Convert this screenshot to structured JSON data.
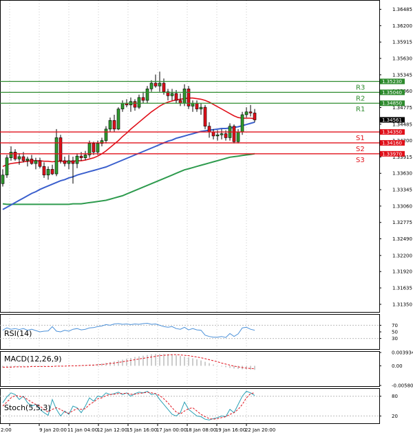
{
  "chart_data": {
    "type": "candlestick",
    "price_axis_ticks": [
      "1.36485",
      "1.36200",
      "1.35915",
      "1.35630",
      "1.35345",
      "1.35060",
      "1.34775",
      "1.34485",
      "1.34200",
      "1.33915",
      "1.33630",
      "1.33345",
      "1.33060",
      "1.32775",
      "1.32490",
      "1.32200",
      "1.31920",
      "1.31635",
      "1.31350"
    ],
    "ylim": [
      1.31205,
      1.36635
    ],
    "x_tick_labels": [
      "2:00",
      "9 Jan 20:00",
      "11 Jan 04:00",
      "12 Jan 12:00",
      "15 Jan 16:00",
      "17 Jan 00:00",
      "18 Jan 08:00",
      "19 Jan 16:00",
      "22 Jan 20:00"
    ],
    "current_price": {
      "label": "1.34561",
      "value": 1.34561
    },
    "levels": [
      {
        "name": "R3",
        "value": 1.3523,
        "label": "1.35230",
        "color": "#2e8b2e"
      },
      {
        "name": "R2",
        "value": 1.3504,
        "label": "1.35040",
        "color": "#2e8b2e"
      },
      {
        "name": "R1",
        "value": 1.3485,
        "label": "1.34850",
        "color": "#2e8b2e"
      },
      {
        "name": "S1",
        "value": 1.3435,
        "label": "1.34350",
        "color": "#e0101a"
      },
      {
        "name": "S2",
        "value": 1.3416,
        "label": "1.34160",
        "color": "#e0101a"
      },
      {
        "name": "S3",
        "value": 1.3397,
        "label": "1.33970",
        "color": "#e0101a"
      }
    ],
    "candles": [
      {
        "o": 1.3345,
        "h": 1.337,
        "l": 1.334,
        "c": 1.336
      },
      {
        "o": 1.336,
        "h": 1.3395,
        "l": 1.3355,
        "c": 1.339
      },
      {
        "o": 1.339,
        "h": 1.341,
        "l": 1.3385,
        "c": 1.34
      },
      {
        "o": 1.34,
        "h": 1.3405,
        "l": 1.3385,
        "c": 1.3388
      },
      {
        "o": 1.3388,
        "h": 1.3398,
        "l": 1.3378,
        "c": 1.3392
      },
      {
        "o": 1.3392,
        "h": 1.34,
        "l": 1.3382,
        "c": 1.3385
      },
      {
        "o": 1.3385,
        "h": 1.3392,
        "l": 1.3375,
        "c": 1.3388
      },
      {
        "o": 1.3388,
        "h": 1.3395,
        "l": 1.3378,
        "c": 1.338
      },
      {
        "o": 1.338,
        "h": 1.339,
        "l": 1.337,
        "c": 1.3385
      },
      {
        "o": 1.3385,
        "h": 1.339,
        "l": 1.3372,
        "c": 1.3375
      },
      {
        "o": 1.3375,
        "h": 1.3382,
        "l": 1.3355,
        "c": 1.336
      },
      {
        "o": 1.336,
        "h": 1.3375,
        "l": 1.3352,
        "c": 1.337
      },
      {
        "o": 1.337,
        "h": 1.3378,
        "l": 1.336,
        "c": 1.3362
      },
      {
        "o": 1.3362,
        "h": 1.344,
        "l": 1.3358,
        "c": 1.3425
      },
      {
        "o": 1.3425,
        "h": 1.343,
        "l": 1.338,
        "c": 1.3385
      },
      {
        "o": 1.3385,
        "h": 1.3392,
        "l": 1.3375,
        "c": 1.338
      },
      {
        "o": 1.338,
        "h": 1.3395,
        "l": 1.337,
        "c": 1.3385
      },
      {
        "o": 1.3385,
        "h": 1.3392,
        "l": 1.3345,
        "c": 1.338
      },
      {
        "o": 1.338,
        "h": 1.3398,
        "l": 1.3372,
        "c": 1.3393
      },
      {
        "o": 1.3393,
        "h": 1.34,
        "l": 1.3385,
        "c": 1.339
      },
      {
        "o": 1.339,
        "h": 1.3402,
        "l": 1.3386,
        "c": 1.3395
      },
      {
        "o": 1.3395,
        "h": 1.342,
        "l": 1.339,
        "c": 1.3415
      },
      {
        "o": 1.3415,
        "h": 1.3418,
        "l": 1.3395,
        "c": 1.34
      },
      {
        "o": 1.34,
        "h": 1.342,
        "l": 1.3395,
        "c": 1.3415
      },
      {
        "o": 1.3415,
        "h": 1.3425,
        "l": 1.341,
        "c": 1.342
      },
      {
        "o": 1.342,
        "h": 1.3445,
        "l": 1.3415,
        "c": 1.344
      },
      {
        "o": 1.344,
        "h": 1.346,
        "l": 1.3435,
        "c": 1.3455
      },
      {
        "o": 1.3455,
        "h": 1.3465,
        "l": 1.3435,
        "c": 1.344
      },
      {
        "o": 1.344,
        "h": 1.3478,
        "l": 1.3438,
        "c": 1.3475
      },
      {
        "o": 1.3475,
        "h": 1.349,
        "l": 1.347,
        "c": 1.3485
      },
      {
        "o": 1.3485,
        "h": 1.3492,
        "l": 1.3478,
        "c": 1.3482
      },
      {
        "o": 1.3482,
        "h": 1.3495,
        "l": 1.347,
        "c": 1.3488
      },
      {
        "o": 1.3488,
        "h": 1.3492,
        "l": 1.3472,
        "c": 1.3478
      },
      {
        "o": 1.3478,
        "h": 1.35,
        "l": 1.3475,
        "c": 1.3495
      },
      {
        "o": 1.3495,
        "h": 1.3505,
        "l": 1.3485,
        "c": 1.349
      },
      {
        "o": 1.349,
        "h": 1.3515,
        "l": 1.3485,
        "c": 1.351
      },
      {
        "o": 1.351,
        "h": 1.3525,
        "l": 1.3505,
        "c": 1.352
      },
      {
        "o": 1.352,
        "h": 1.3535,
        "l": 1.3512,
        "c": 1.3515
      },
      {
        "o": 1.3515,
        "h": 1.354,
        "l": 1.3505,
        "c": 1.352
      },
      {
        "o": 1.352,
        "h": 1.3528,
        "l": 1.35,
        "c": 1.3505
      },
      {
        "o": 1.3505,
        "h": 1.351,
        "l": 1.349,
        "c": 1.3498
      },
      {
        "o": 1.3498,
        "h": 1.351,
        "l": 1.349,
        "c": 1.3502
      },
      {
        "o": 1.3502,
        "h": 1.3508,
        "l": 1.3485,
        "c": 1.349
      },
      {
        "o": 1.349,
        "h": 1.3502,
        "l": 1.348,
        "c": 1.3485
      },
      {
        "o": 1.3485,
        "h": 1.3518,
        "l": 1.348,
        "c": 1.351
      },
      {
        "o": 1.351,
        "h": 1.3515,
        "l": 1.3475,
        "c": 1.348
      },
      {
        "o": 1.348,
        "h": 1.349,
        "l": 1.347,
        "c": 1.3485
      },
      {
        "o": 1.3485,
        "h": 1.349,
        "l": 1.347,
        "c": 1.3475
      },
      {
        "o": 1.3475,
        "h": 1.3485,
        "l": 1.3465,
        "c": 1.3478
      },
      {
        "o": 1.3478,
        "h": 1.3482,
        "l": 1.344,
        "c": 1.3445
      },
      {
        "o": 1.3445,
        "h": 1.3452,
        "l": 1.3425,
        "c": 1.3435
      },
      {
        "o": 1.3435,
        "h": 1.344,
        "l": 1.3422,
        "c": 1.3428
      },
      {
        "o": 1.3428,
        "h": 1.3438,
        "l": 1.342,
        "c": 1.343
      },
      {
        "o": 1.343,
        "h": 1.344,
        "l": 1.3422,
        "c": 1.3432
      },
      {
        "o": 1.3432,
        "h": 1.3438,
        "l": 1.342,
        "c": 1.3425
      },
      {
        "o": 1.3425,
        "h": 1.345,
        "l": 1.342,
        "c": 1.3445
      },
      {
        "o": 1.3445,
        "h": 1.3448,
        "l": 1.3415,
        "c": 1.3418
      },
      {
        "o": 1.3418,
        "h": 1.344,
        "l": 1.3415,
        "c": 1.3435
      },
      {
        "o": 1.3435,
        "h": 1.347,
        "l": 1.343,
        "c": 1.3465
      },
      {
        "o": 1.3465,
        "h": 1.3478,
        "l": 1.346,
        "c": 1.347
      },
      {
        "o": 1.347,
        "h": 1.3482,
        "l": 1.3462,
        "c": 1.3468
      },
      {
        "o": 1.3468,
        "h": 1.3475,
        "l": 1.3452,
        "c": 1.3456
      }
    ],
    "ma_red": [
      1.3375,
      1.3378,
      1.338,
      1.3381,
      1.3382,
      1.3383,
      1.3384,
      1.3385,
      1.3385,
      1.3385,
      1.3384,
      1.3384,
      1.3383,
      1.3384,
      1.3384,
      1.3384,
      1.3384,
      1.3384,
      1.3385,
      1.3385,
      1.3386,
      1.3388,
      1.339,
      1.3393,
      1.3397,
      1.3402,
      1.3408,
      1.3414,
      1.342,
      1.3427,
      1.3433,
      1.344,
      1.3446,
      1.3452,
      1.3458,
      1.3464,
      1.347,
      1.3475,
      1.348,
      1.3484,
      1.3487,
      1.3489,
      1.3491,
      1.3492,
      1.3493,
      1.3494,
      1.3494,
      1.3493,
      1.3492,
      1.349,
      1.3487,
      1.3483,
      1.3479,
      1.3475,
      1.3471,
      1.3467,
      1.3463,
      1.346,
      1.3459,
      1.3459,
      1.3459,
      1.3458
    ],
    "ma_blue": [
      1.33,
      1.3304,
      1.3308,
      1.3312,
      1.3316,
      1.332,
      1.3324,
      1.3328,
      1.3331,
      1.3335,
      1.3338,
      1.3341,
      1.3344,
      1.3347,
      1.335,
      1.3352,
      1.3355,
      1.3357,
      1.336,
      1.3362,
      1.3364,
      1.3366,
      1.3368,
      1.337,
      1.3372,
      1.3374,
      1.3377,
      1.338,
      1.3383,
      1.3386,
      1.3389,
      1.3392,
      1.3395,
      1.3398,
      1.3401,
      1.3404,
      1.3407,
      1.341,
      1.3413,
      1.3416,
      1.3419,
      1.3421,
      1.3424,
      1.3426,
      1.3428,
      1.343,
      1.3432,
      1.3434,
      1.3436,
      1.3437,
      1.3438,
      1.3439,
      1.344,
      1.3441,
      1.3441,
      1.3442,
      1.3443,
      1.3444,
      1.3446,
      1.3448,
      1.345,
      1.3452
    ],
    "ma_green": [
      1.331,
      1.3309,
      1.3309,
      1.3309,
      1.3309,
      1.3309,
      1.3309,
      1.3309,
      1.3309,
      1.3309,
      1.3309,
      1.3309,
      1.3309,
      1.3309,
      1.3309,
      1.3309,
      1.3309,
      1.331,
      1.331,
      1.331,
      1.3311,
      1.3312,
      1.3313,
      1.3314,
      1.3315,
      1.3316,
      1.3318,
      1.332,
      1.3322,
      1.3324,
      1.3327,
      1.333,
      1.3333,
      1.3336,
      1.3339,
      1.3342,
      1.3345,
      1.3348,
      1.3351,
      1.3354,
      1.3357,
      1.336,
      1.3363,
      1.3366,
      1.3369,
      1.3371,
      1.3373,
      1.3375,
      1.3377,
      1.3379,
      1.3381,
      1.3383,
      1.3385,
      1.3387,
      1.3389,
      1.3391,
      1.3392,
      1.3393,
      1.3394,
      1.3395,
      1.3396,
      1.3397
    ],
    "rsi": {
      "title": "RSI(14)",
      "ticks": [
        "70",
        "50",
        "30"
      ],
      "ylim": [
        0,
        100
      ],
      "values": [
        55,
        62,
        58,
        60,
        57,
        60,
        55,
        58,
        54,
        50,
        52,
        53,
        66,
        52,
        50,
        55,
        52,
        58,
        60,
        56,
        58,
        62,
        63,
        66,
        68,
        72,
        70,
        74,
        75,
        73,
        74,
        72,
        74,
        73,
        75,
        76,
        73,
        74,
        70,
        66,
        64,
        66,
        60,
        58,
        64,
        56,
        60,
        56,
        55,
        40,
        36,
        34,
        34,
        36,
        33,
        45,
        36,
        44,
        62,
        64,
        58,
        55
      ]
    },
    "macd": {
      "title": "MACD(12,26,9)",
      "ticks": [
        "0.003934",
        "0.00",
        "-0.005803"
      ],
      "ylim": [
        -0.005803,
        0.003934
      ],
      "histogram": [
        -0.0005,
        -0.0004,
        -0.0003,
        -0.0003,
        -0.0002,
        -0.0002,
        -0.0002,
        -0.0002,
        -0.0002,
        -0.0002,
        -0.0002,
        -0.0002,
        -0.0001,
        -0.0001,
        -0.0001,
        0.0,
        0.0,
        0.0,
        0.0001,
        0.0001,
        0.0002,
        0.0003,
        0.0004,
        0.0005,
        0.0007,
        0.0009,
        0.0011,
        0.0013,
        0.0016,
        0.0018,
        0.0021,
        0.0023,
        0.0026,
        0.0028,
        0.003,
        0.0032,
        0.0034,
        0.0035,
        0.0035,
        0.0035,
        0.0034,
        0.0033,
        0.0031,
        0.0029,
        0.0027,
        0.0025,
        0.0022,
        0.0019,
        0.0016,
        0.0012,
        0.0008,
        0.0004,
        0.0001,
        -0.0002,
        -0.0004,
        -0.0006,
        -0.0008,
        -0.0009,
        -0.001,
        -0.001,
        -0.0011,
        -0.0012
      ],
      "signal": [
        -0.0004,
        -0.0004,
        -0.0004,
        -0.0003,
        -0.0003,
        -0.0003,
        -0.0003,
        -0.0002,
        -0.0002,
        -0.0002,
        -0.0002,
        -0.0002,
        -0.0002,
        -0.0001,
        -0.0001,
        -0.0001,
        0.0,
        0.0,
        0.0,
        0.0001,
        0.0001,
        0.0002,
        0.0002,
        0.0003,
        0.0004,
        0.0005,
        0.0007,
        0.0008,
        0.001,
        0.0012,
        0.0014,
        0.0016,
        0.0018,
        0.002,
        0.0022,
        0.0024,
        0.0026,
        0.0028,
        0.003,
        0.0031,
        0.0032,
        0.0033,
        0.0033,
        0.0032,
        0.0031,
        0.003,
        0.0028,
        0.0026,
        0.0024,
        0.0021,
        0.0018,
        0.0015,
        0.0012,
        0.0008,
        0.0005,
        0.0002,
        -0.0001,
        -0.0003,
        -0.0005,
        -0.0007,
        -0.0008,
        -0.0009
      ]
    },
    "stoch": {
      "title": "Stoch(5,5,3)",
      "ticks": [
        "80",
        "20"
      ],
      "ylim": [
        0,
        100
      ],
      "k": [
        60,
        78,
        90,
        85,
        70,
        80,
        60,
        50,
        55,
        40,
        30,
        22,
        70,
        40,
        20,
        35,
        25,
        50,
        45,
        30,
        50,
        75,
        65,
        80,
        78,
        90,
        85,
        88,
        92,
        85,
        90,
        80,
        88,
        92,
        90,
        95,
        85,
        88,
        70,
        55,
        40,
        25,
        20,
        30,
        62,
        40,
        30,
        20,
        18,
        10,
        8,
        12,
        15,
        20,
        18,
        40,
        30,
        55,
        80,
        95,
        90,
        82
      ],
      "d": [
        50,
        62,
        75,
        82,
        80,
        78,
        70,
        62,
        55,
        50,
        40,
        32,
        40,
        45,
        40,
        32,
        28,
        36,
        42,
        40,
        42,
        55,
        62,
        72,
        75,
        82,
        85,
        86,
        88,
        88,
        89,
        86,
        86,
        88,
        90,
        92,
        90,
        88,
        82,
        72,
        60,
        45,
        32,
        26,
        35,
        42,
        45,
        35,
        25,
        18,
        12,
        10,
        12,
        15,
        18,
        25,
        30,
        40,
        55,
        75,
        88,
        90
      ]
    }
  }
}
